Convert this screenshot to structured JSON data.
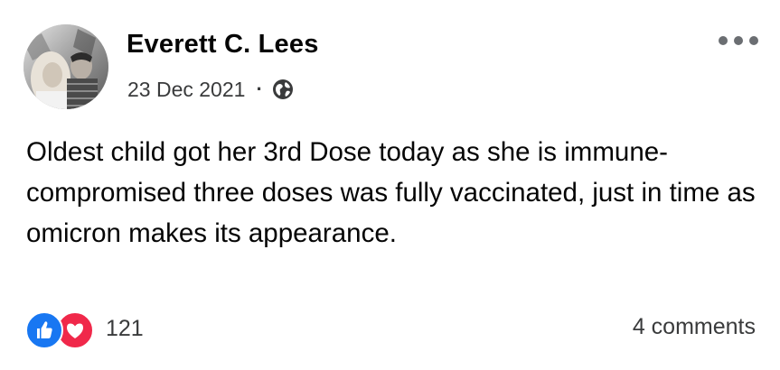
{
  "post": {
    "author": {
      "name": "Everett C. Lees",
      "avatar_icon": "profile-photo-avatar"
    },
    "timestamp": "23 Dec 2021",
    "separator": "·",
    "privacy_icon": "globe-icon",
    "menu_icon": "more-options-icon",
    "text": "Oldest child got her 3rd Dose today as she is immune-compromised three doses was fully vaccinated, just in time as omicron makes its appearance.",
    "reactions": {
      "icons": [
        "like-icon",
        "love-icon"
      ],
      "count": "121"
    },
    "comments": "4 comments"
  },
  "colors": {
    "like": "#1877f2",
    "love": "#f0284a",
    "text": "#050505",
    "secondary_text": "#3a3b3c",
    "menu_dots": "#6b6e72"
  }
}
